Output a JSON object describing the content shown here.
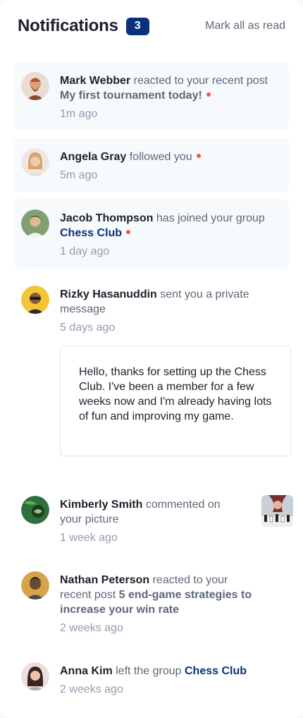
{
  "header": {
    "title": "Notifications",
    "unread_count": "3",
    "mark_all_label": "Mark all as read"
  },
  "colors": {
    "accent": "#0a327b",
    "unread_dot": "#f65552",
    "unread_bg": "#f7fafd"
  },
  "notifications": [
    {
      "actor": "Mark Webber",
      "action": "reacted to your recent post",
      "target": "My first tournament today!",
      "time": "1m ago",
      "unread": true,
      "avatar_icon": "avatar-mark-webber"
    },
    {
      "actor": "Angela Gray",
      "action": "followed you",
      "time": "5m ago",
      "unread": true,
      "avatar_icon": "avatar-angela-gray"
    },
    {
      "actor": "Jacob Thompson",
      "action": "has joined your group",
      "target": "Chess Club",
      "time": "1 day ago",
      "unread": true,
      "avatar_icon": "avatar-jacob-thompson"
    },
    {
      "actor": "Rizky Hasanuddin",
      "action": "sent you a private message",
      "time": "5 days ago",
      "unread": false,
      "avatar_icon": "avatar-rizky-hasanuddin",
      "message": "Hello, thanks for setting up the Chess Club. I've been a member for a few weeks now and I'm already having lots of fun and improving my game."
    },
    {
      "actor": "Kimberly Smith",
      "action": "commented on your picture",
      "time": "1 week ago",
      "unread": false,
      "avatar_icon": "avatar-kimberly-smith",
      "picture_icon": "chess-picture-thumbnail"
    },
    {
      "actor": "Nathan Peterson",
      "action": "reacted to your recent post",
      "target": "5 end-game strategies to increase your win rate",
      "time": "2 weeks ago",
      "unread": false,
      "avatar_icon": "avatar-nathan-peterson"
    },
    {
      "actor": "Anna Kim",
      "action": "left the group",
      "target": "Chess Club",
      "time": "2 weeks ago",
      "unread": false,
      "avatar_icon": "avatar-anna-kim"
    }
  ]
}
